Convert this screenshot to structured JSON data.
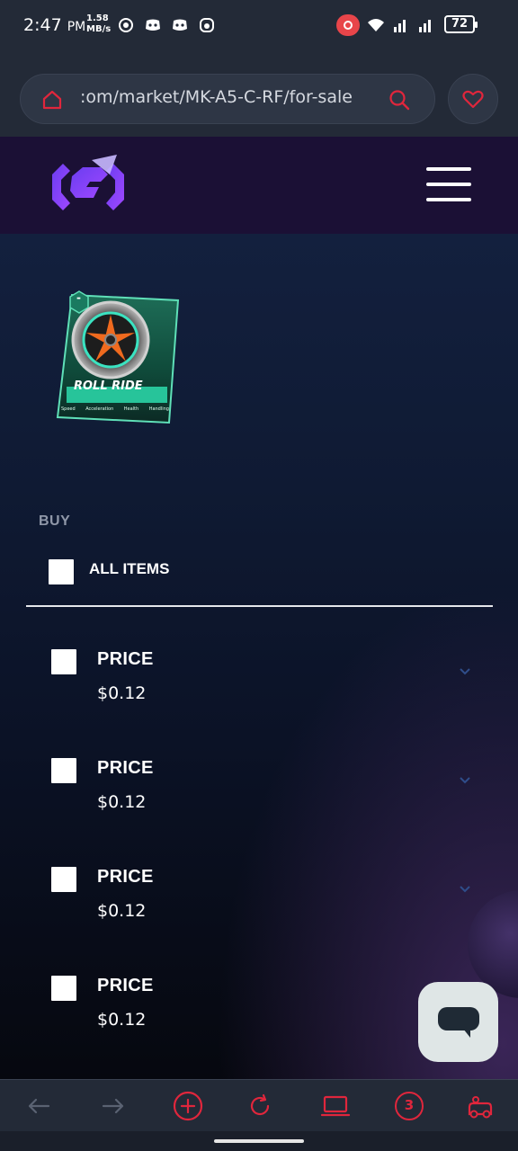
{
  "status_bar": {
    "time": "2:47",
    "ampm": "PM",
    "net_speed_value": "1.58",
    "net_speed_unit": "MB/s",
    "battery": "72"
  },
  "browser": {
    "url": ":om/market/MK-A5-C-RF/for-sale"
  },
  "card": {
    "badge": "-",
    "title": "ROLL RIDE",
    "stats": [
      "Speed",
      "Acceleration",
      "Health",
      "Handling"
    ]
  },
  "buy": {
    "section_label": "BUY",
    "all_items_label": "ALL ITEMS",
    "items": [
      {
        "label": "PRICE",
        "value": "$0.12"
      },
      {
        "label": "PRICE",
        "value": "$0.12"
      },
      {
        "label": "PRICE",
        "value": "$0.12"
      },
      {
        "label": "PRICE",
        "value": "$0.12"
      }
    ]
  },
  "toolbar": {
    "tab_count": "3"
  },
  "colors": {
    "accent": "#e0263c",
    "header_bg": "#1b1035",
    "browser_bg": "#232a37"
  }
}
